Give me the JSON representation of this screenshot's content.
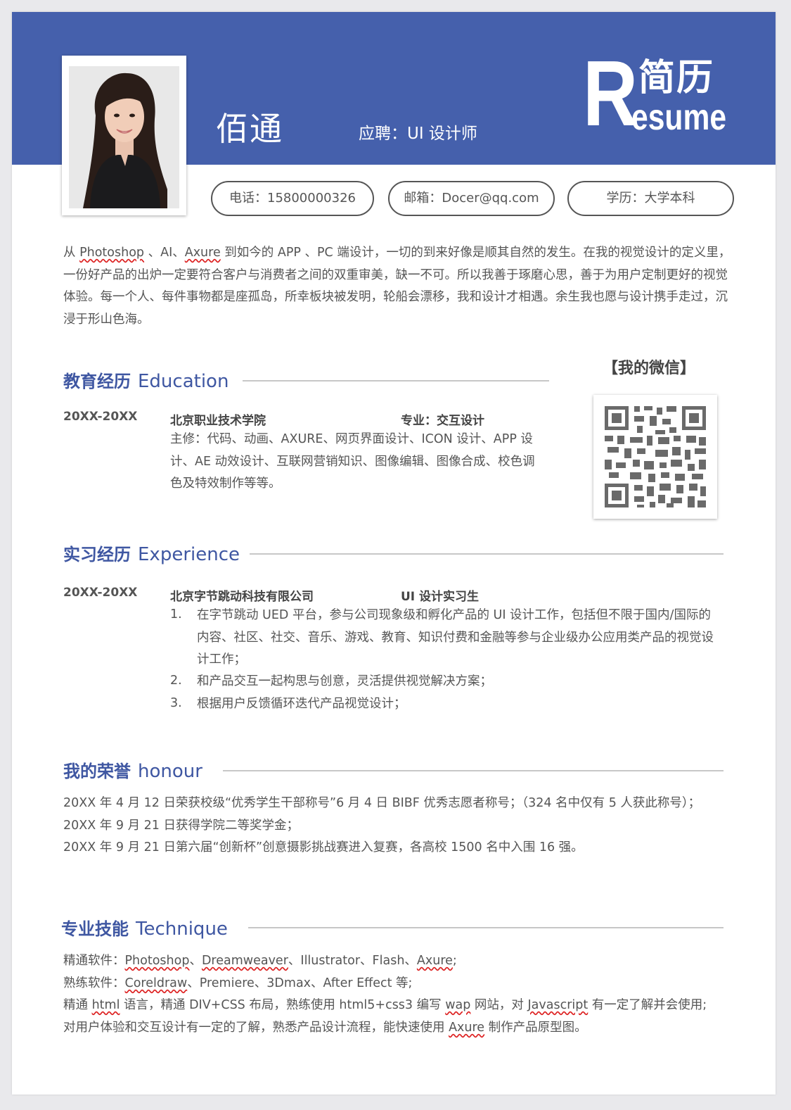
{
  "header": {
    "name": "佰通",
    "apply": "应聘：UI 设计师",
    "logo_letter": "R",
    "logo_cn": "简历",
    "logo_en": "esume"
  },
  "contacts": [
    {
      "label": "电话：15800000326"
    },
    {
      "label": "邮箱：Docer@qq.com"
    },
    {
      "label": "学历：大学本科"
    }
  ],
  "intro": {
    "p1": "从 ",
    "photoshop": "Photoshop",
    "p2": " 、AI、",
    "axure": "Axure",
    "p3": " 到如今的 APP 、PC 端设计，一切的到来好像是顺其自然的发生。在我的视觉设计的定义里，一份好产品的出炉一定要符合客户与消费者之间的双重审美，缺一不可。所以我善于琢磨心思，善于为用户定制更好的视觉体验。每一个人、每件事物都是座孤岛，所幸板块被发明，轮船会漂移，我和设计才相遇。余生我也愿与设计携手走过，沉浸于形山色海。"
  },
  "wechat": {
    "title": "【我的微信】"
  },
  "education": {
    "title_cn": "教育经历",
    "title_en": "Education",
    "date": "20XX-20XX",
    "school": "北京职业技术学院",
    "major": "专业：交互设计",
    "courses": "主修：代码、动画、AXURE、网页界面设计、ICON 设计、APP 设计、AE 动效设计、互联网营销知识、图像编辑、图像合成、校色调色及特效制作等等。"
  },
  "experience": {
    "title_cn": "实习经历",
    "title_en": "Experience",
    "date": "20XX-20XX",
    "company": "北京字节跳动科技有限公司",
    "role": "UI 设计实习生",
    "items": [
      {
        "n": "1.",
        "text": "在字节跳动 UED 平台，参与公司现象级和孵化产品的 UI 设计工作，包括但不限于国内/国际的内容、社区、社交、音乐、游戏、教育、知识付费和金融等参与企业级办公应用类产品的视觉设计工作；"
      },
      {
        "n": "2.",
        "text": "和产品交互一起构思与创意，灵活提供视觉解决方案；"
      },
      {
        "n": "3.",
        "text": "根据用户反馈循环迭代产品视觉设计；"
      }
    ]
  },
  "honour": {
    "title_cn": "我的荣誉",
    "title_en": "honour",
    "lines": [
      "20XX 年 4 月 12 日荣获校级“优秀学生干部称号”6 月 4 日 BIBF 优秀志愿者称号；（324 名中仅有 5 人获此称号）；",
      "20XX 年 9 月 21 日获得学院二等奖学金；",
      "20XX 年 9 月 21 日第六届“创新杯”创意摄影挑战赛进入复赛，各高校 1500 名中入围 16 强。"
    ]
  },
  "technique": {
    "title_cn": "专业技能",
    "title_en": "Technique",
    "line1_prefix": "精通软件：",
    "line1_a": "Photoshop",
    "line1_sep1": "、",
    "line1_b": "Dreamweaver",
    "line1_mid": "、Illustrator、Flash、",
    "line1_c": "Axure",
    "line1_end": ";",
    "line2_prefix": "熟练软件：",
    "line2_a": "Coreldraw",
    "line2_rest": "、Premiere、3Dmax、After Effect 等;",
    "line3_a": "精通 ",
    "line3_html": "html",
    "line3_b": " 语言，精通 DIV+CSS 布局，熟练使用 html5+css3 编写 ",
    "line3_wap": "wap",
    "line3_c": " 网站，对 ",
    "line3_js": "Javascript",
    "line3_d": " 有一定了解并会使用;",
    "line4_a": "对用户体验和交互设计有一定的了解，熟悉产品设计流程，能快速使用 ",
    "line4_axure": "Axure",
    "line4_b": " 制作产品原型图。"
  },
  "colors": {
    "banner": "#4560ac",
    "section_title": "#3f57a2",
    "body_text": "#555555",
    "qr": "#6a6a6a"
  }
}
